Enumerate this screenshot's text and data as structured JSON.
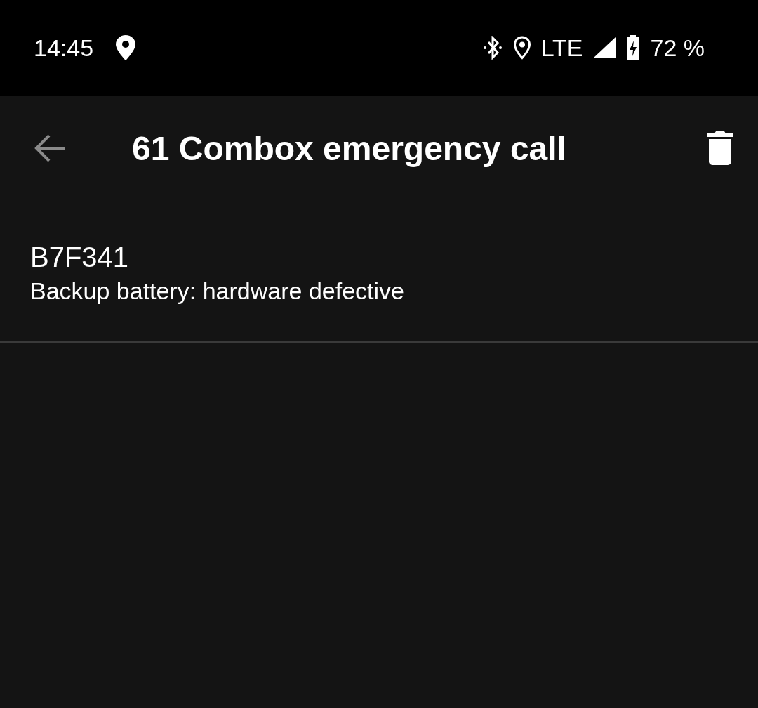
{
  "status_bar": {
    "time": "14:45",
    "network": "LTE",
    "battery": "72 %"
  },
  "app_bar": {
    "title": "61 Combox emergency call"
  },
  "items": [
    {
      "code": "B7F341",
      "description": "Backup battery: hardware defective"
    }
  ]
}
